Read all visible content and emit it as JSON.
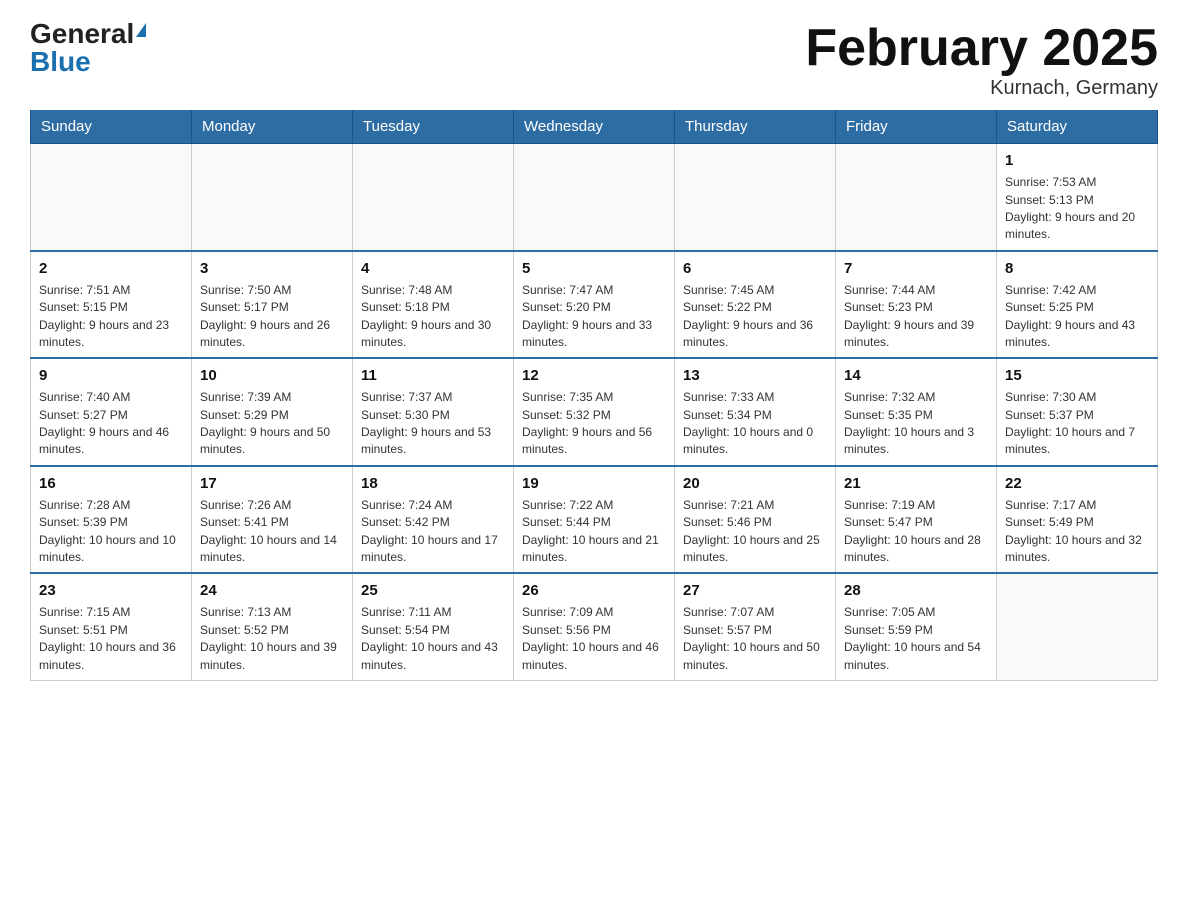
{
  "header": {
    "logo_general": "General",
    "logo_blue": "Blue",
    "month_title": "February 2025",
    "location": "Kurnach, Germany"
  },
  "days_of_week": [
    "Sunday",
    "Monday",
    "Tuesday",
    "Wednesday",
    "Thursday",
    "Friday",
    "Saturday"
  ],
  "weeks": [
    [
      {
        "day": "",
        "info": ""
      },
      {
        "day": "",
        "info": ""
      },
      {
        "day": "",
        "info": ""
      },
      {
        "day": "",
        "info": ""
      },
      {
        "day": "",
        "info": ""
      },
      {
        "day": "",
        "info": ""
      },
      {
        "day": "1",
        "info": "Sunrise: 7:53 AM\nSunset: 5:13 PM\nDaylight: 9 hours and 20 minutes."
      }
    ],
    [
      {
        "day": "2",
        "info": "Sunrise: 7:51 AM\nSunset: 5:15 PM\nDaylight: 9 hours and 23 minutes."
      },
      {
        "day": "3",
        "info": "Sunrise: 7:50 AM\nSunset: 5:17 PM\nDaylight: 9 hours and 26 minutes."
      },
      {
        "day": "4",
        "info": "Sunrise: 7:48 AM\nSunset: 5:18 PM\nDaylight: 9 hours and 30 minutes."
      },
      {
        "day": "5",
        "info": "Sunrise: 7:47 AM\nSunset: 5:20 PM\nDaylight: 9 hours and 33 minutes."
      },
      {
        "day": "6",
        "info": "Sunrise: 7:45 AM\nSunset: 5:22 PM\nDaylight: 9 hours and 36 minutes."
      },
      {
        "day": "7",
        "info": "Sunrise: 7:44 AM\nSunset: 5:23 PM\nDaylight: 9 hours and 39 minutes."
      },
      {
        "day": "8",
        "info": "Sunrise: 7:42 AM\nSunset: 5:25 PM\nDaylight: 9 hours and 43 minutes."
      }
    ],
    [
      {
        "day": "9",
        "info": "Sunrise: 7:40 AM\nSunset: 5:27 PM\nDaylight: 9 hours and 46 minutes."
      },
      {
        "day": "10",
        "info": "Sunrise: 7:39 AM\nSunset: 5:29 PM\nDaylight: 9 hours and 50 minutes."
      },
      {
        "day": "11",
        "info": "Sunrise: 7:37 AM\nSunset: 5:30 PM\nDaylight: 9 hours and 53 minutes."
      },
      {
        "day": "12",
        "info": "Sunrise: 7:35 AM\nSunset: 5:32 PM\nDaylight: 9 hours and 56 minutes."
      },
      {
        "day": "13",
        "info": "Sunrise: 7:33 AM\nSunset: 5:34 PM\nDaylight: 10 hours and 0 minutes."
      },
      {
        "day": "14",
        "info": "Sunrise: 7:32 AM\nSunset: 5:35 PM\nDaylight: 10 hours and 3 minutes."
      },
      {
        "day": "15",
        "info": "Sunrise: 7:30 AM\nSunset: 5:37 PM\nDaylight: 10 hours and 7 minutes."
      }
    ],
    [
      {
        "day": "16",
        "info": "Sunrise: 7:28 AM\nSunset: 5:39 PM\nDaylight: 10 hours and 10 minutes."
      },
      {
        "day": "17",
        "info": "Sunrise: 7:26 AM\nSunset: 5:41 PM\nDaylight: 10 hours and 14 minutes."
      },
      {
        "day": "18",
        "info": "Sunrise: 7:24 AM\nSunset: 5:42 PM\nDaylight: 10 hours and 17 minutes."
      },
      {
        "day": "19",
        "info": "Sunrise: 7:22 AM\nSunset: 5:44 PM\nDaylight: 10 hours and 21 minutes."
      },
      {
        "day": "20",
        "info": "Sunrise: 7:21 AM\nSunset: 5:46 PM\nDaylight: 10 hours and 25 minutes."
      },
      {
        "day": "21",
        "info": "Sunrise: 7:19 AM\nSunset: 5:47 PM\nDaylight: 10 hours and 28 minutes."
      },
      {
        "day": "22",
        "info": "Sunrise: 7:17 AM\nSunset: 5:49 PM\nDaylight: 10 hours and 32 minutes."
      }
    ],
    [
      {
        "day": "23",
        "info": "Sunrise: 7:15 AM\nSunset: 5:51 PM\nDaylight: 10 hours and 36 minutes."
      },
      {
        "day": "24",
        "info": "Sunrise: 7:13 AM\nSunset: 5:52 PM\nDaylight: 10 hours and 39 minutes."
      },
      {
        "day": "25",
        "info": "Sunrise: 7:11 AM\nSunset: 5:54 PM\nDaylight: 10 hours and 43 minutes."
      },
      {
        "day": "26",
        "info": "Sunrise: 7:09 AM\nSunset: 5:56 PM\nDaylight: 10 hours and 46 minutes."
      },
      {
        "day": "27",
        "info": "Sunrise: 7:07 AM\nSunset: 5:57 PM\nDaylight: 10 hours and 50 minutes."
      },
      {
        "day": "28",
        "info": "Sunrise: 7:05 AM\nSunset: 5:59 PM\nDaylight: 10 hours and 54 minutes."
      },
      {
        "day": "",
        "info": ""
      }
    ]
  ]
}
